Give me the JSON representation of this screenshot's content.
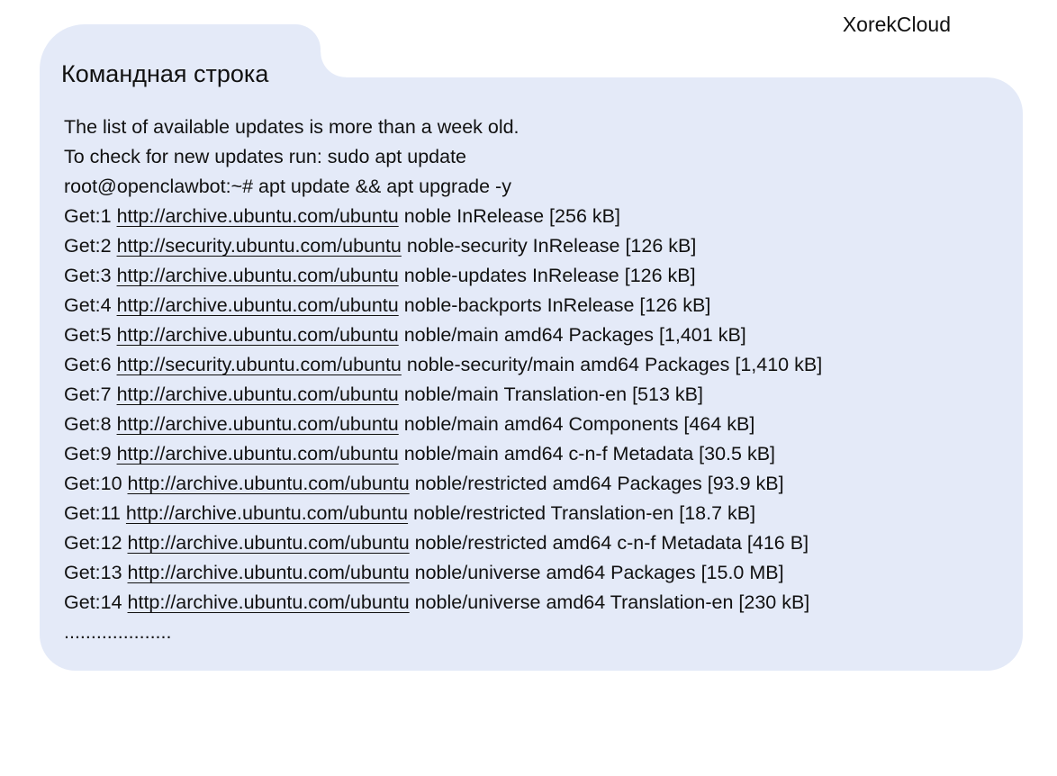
{
  "brand": "XorekCloud",
  "panel_title": "Командная строка",
  "terminal": {
    "intro": [
      "The list of available updates is more than a week old.",
      "To check for new updates run: sudo apt update",
      "root@openclawbot:~# apt update && apt upgrade -y"
    ],
    "gets": [
      {
        "prefix": "Get:1 ",
        "url": "http://archive.ubuntu.com/ubuntu",
        "rest": " noble InRelease [256 kB]"
      },
      {
        "prefix": "Get:2 ",
        "url": "http://security.ubuntu.com/ubuntu",
        "rest": " noble-security InRelease [126 kB]"
      },
      {
        "prefix": "Get:3 ",
        "url": "http://archive.ubuntu.com/ubuntu",
        "rest": " noble-updates InRelease [126 kB]"
      },
      {
        "prefix": "Get:4 ",
        "url": "http://archive.ubuntu.com/ubuntu",
        "rest": " noble-backports InRelease [126 kB]"
      },
      {
        "prefix": "Get:5 ",
        "url": "http://archive.ubuntu.com/ubuntu",
        "rest": " noble/main amd64 Packages [1,401 kB]"
      },
      {
        "prefix": "Get:6 ",
        "url": "http://security.ubuntu.com/ubuntu",
        "rest": " noble-security/main amd64 Packages [1,410 kB]"
      },
      {
        "prefix": "Get:7 ",
        "url": "http://archive.ubuntu.com/ubuntu",
        "rest": " noble/main Translation-en [513 kB]"
      },
      {
        "prefix": "Get:8 ",
        "url": "http://archive.ubuntu.com/ubuntu",
        "rest": " noble/main amd64 Components [464 kB]"
      },
      {
        "prefix": "Get:9 ",
        "url": "http://archive.ubuntu.com/ubuntu",
        "rest": " noble/main amd64 c-n-f Metadata [30.5 kB]"
      },
      {
        "prefix": "Get:10 ",
        "url": "http://archive.ubuntu.com/ubuntu",
        "rest": " noble/restricted amd64 Packages [93.9 kB]"
      },
      {
        "prefix": "Get:11 ",
        "url": "http://archive.ubuntu.com/ubuntu",
        "rest": " noble/restricted Translation-en [18.7 kB]"
      },
      {
        "prefix": "Get:12 ",
        "url": "http://archive.ubuntu.com/ubuntu",
        "rest": " noble/restricted amd64 c-n-f Metadata [416 B]"
      },
      {
        "prefix": "Get:13 ",
        "url": "http://archive.ubuntu.com/ubuntu",
        "rest": " noble/universe amd64 Packages [15.0 MB]"
      },
      {
        "prefix": "Get:14 ",
        "url": "http://archive.ubuntu.com/ubuntu",
        "rest": " noble/universe amd64 Translation-en [230 kB]"
      }
    ],
    "ellipsis": "...................."
  }
}
